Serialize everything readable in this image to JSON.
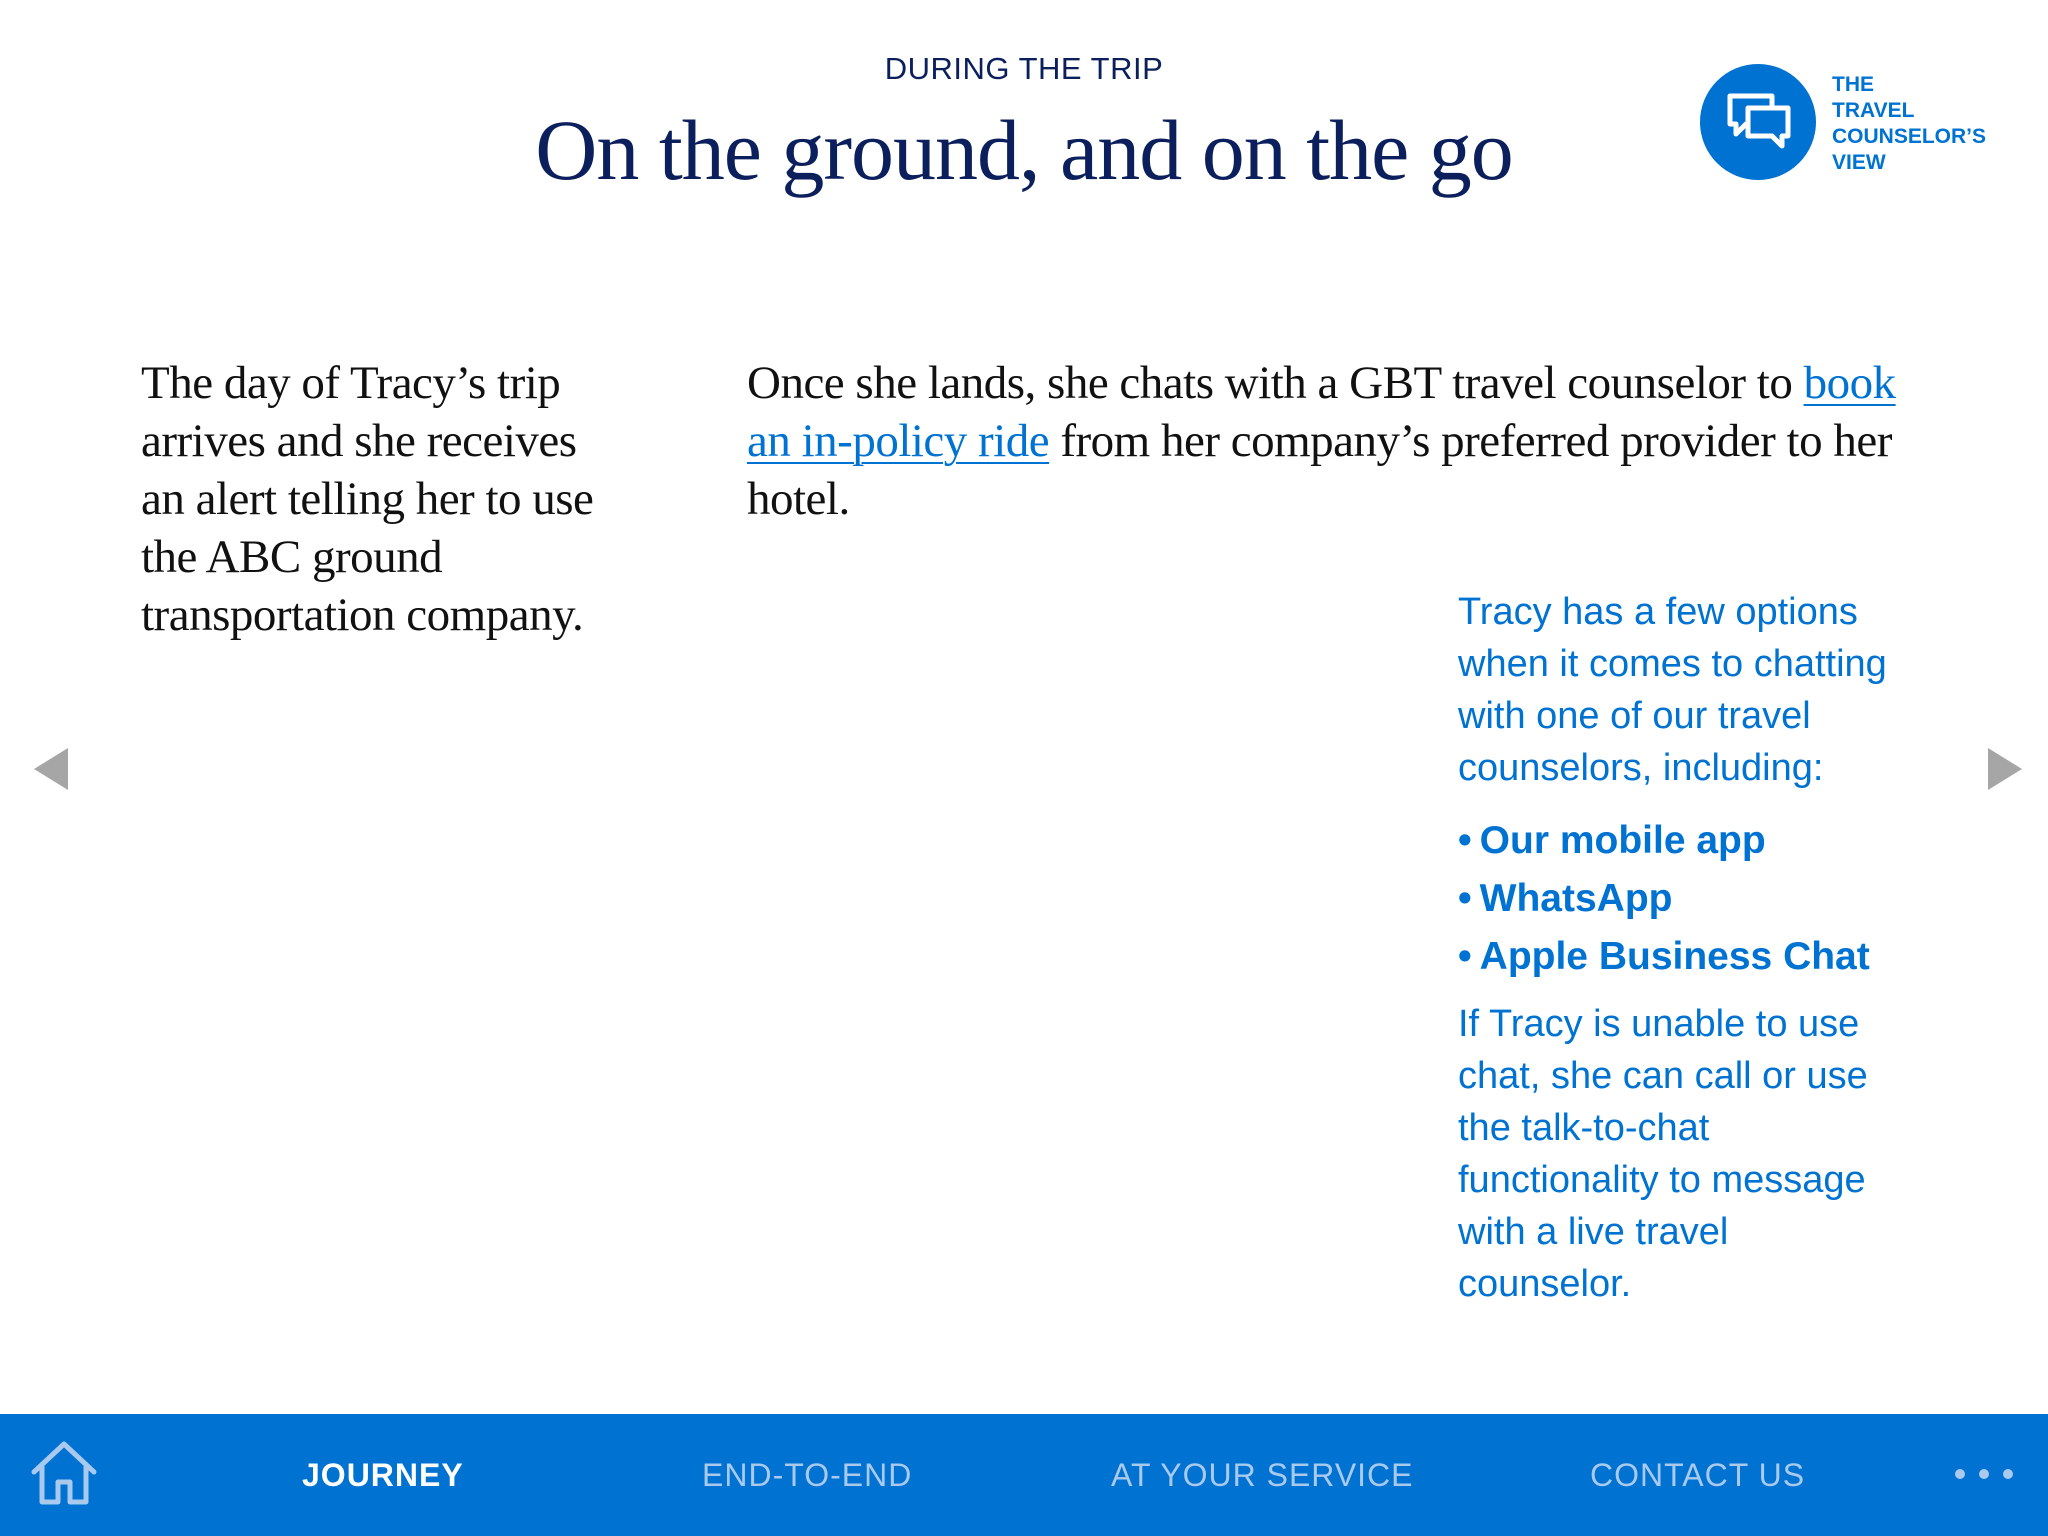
{
  "header": {
    "eyebrow": "DURING THE TRIP",
    "title": "On the ground, and on the go"
  },
  "badge": {
    "icon": "chat-bubbles-icon",
    "lines": [
      "THE",
      "TRAVEL",
      "COUNSELOR’S",
      "VIEW"
    ]
  },
  "left_column": {
    "text": "The day of Tracy’s trip arrives and she receives an alert telling her to use the ABC ground transportation company."
  },
  "center_column": {
    "text_before": "Once she lands, she chats with a GBT travel counselor to ",
    "link": "book an in-policy ride",
    "text_after": " from her company’s preferred provider to her hotel."
  },
  "sidebar": {
    "intro": "Tracy has a few options when it comes to chatting with one of our travel counselors, including:",
    "options": [
      "Our mobile app",
      "WhatsApp",
      "Apple Business Chat"
    ],
    "outro": "If Tracy is unable to use chat, she can call or use the talk-to-chat functionality to message with a live travel counselor."
  },
  "arrows": {
    "prev_icon": "arrow-left-icon",
    "next_icon": "arrow-right-icon"
  },
  "bottom_nav": {
    "home_icon": "home-icon",
    "items": [
      {
        "label": "JOURNEY",
        "active": true
      },
      {
        "label": "END-TO-END",
        "active": false
      },
      {
        "label": "AT YOUR SERVICE",
        "active": false
      },
      {
        "label": "CONTACT US",
        "active": false
      }
    ],
    "more_icon": "more-dots-icon"
  },
  "colors": {
    "brand_blue": "#0072d2",
    "navy": "#0b1f5c",
    "body_text": "#111111",
    "arrow_gray": "#a6a6a6",
    "inactive_nav": "#a9c9ee"
  }
}
